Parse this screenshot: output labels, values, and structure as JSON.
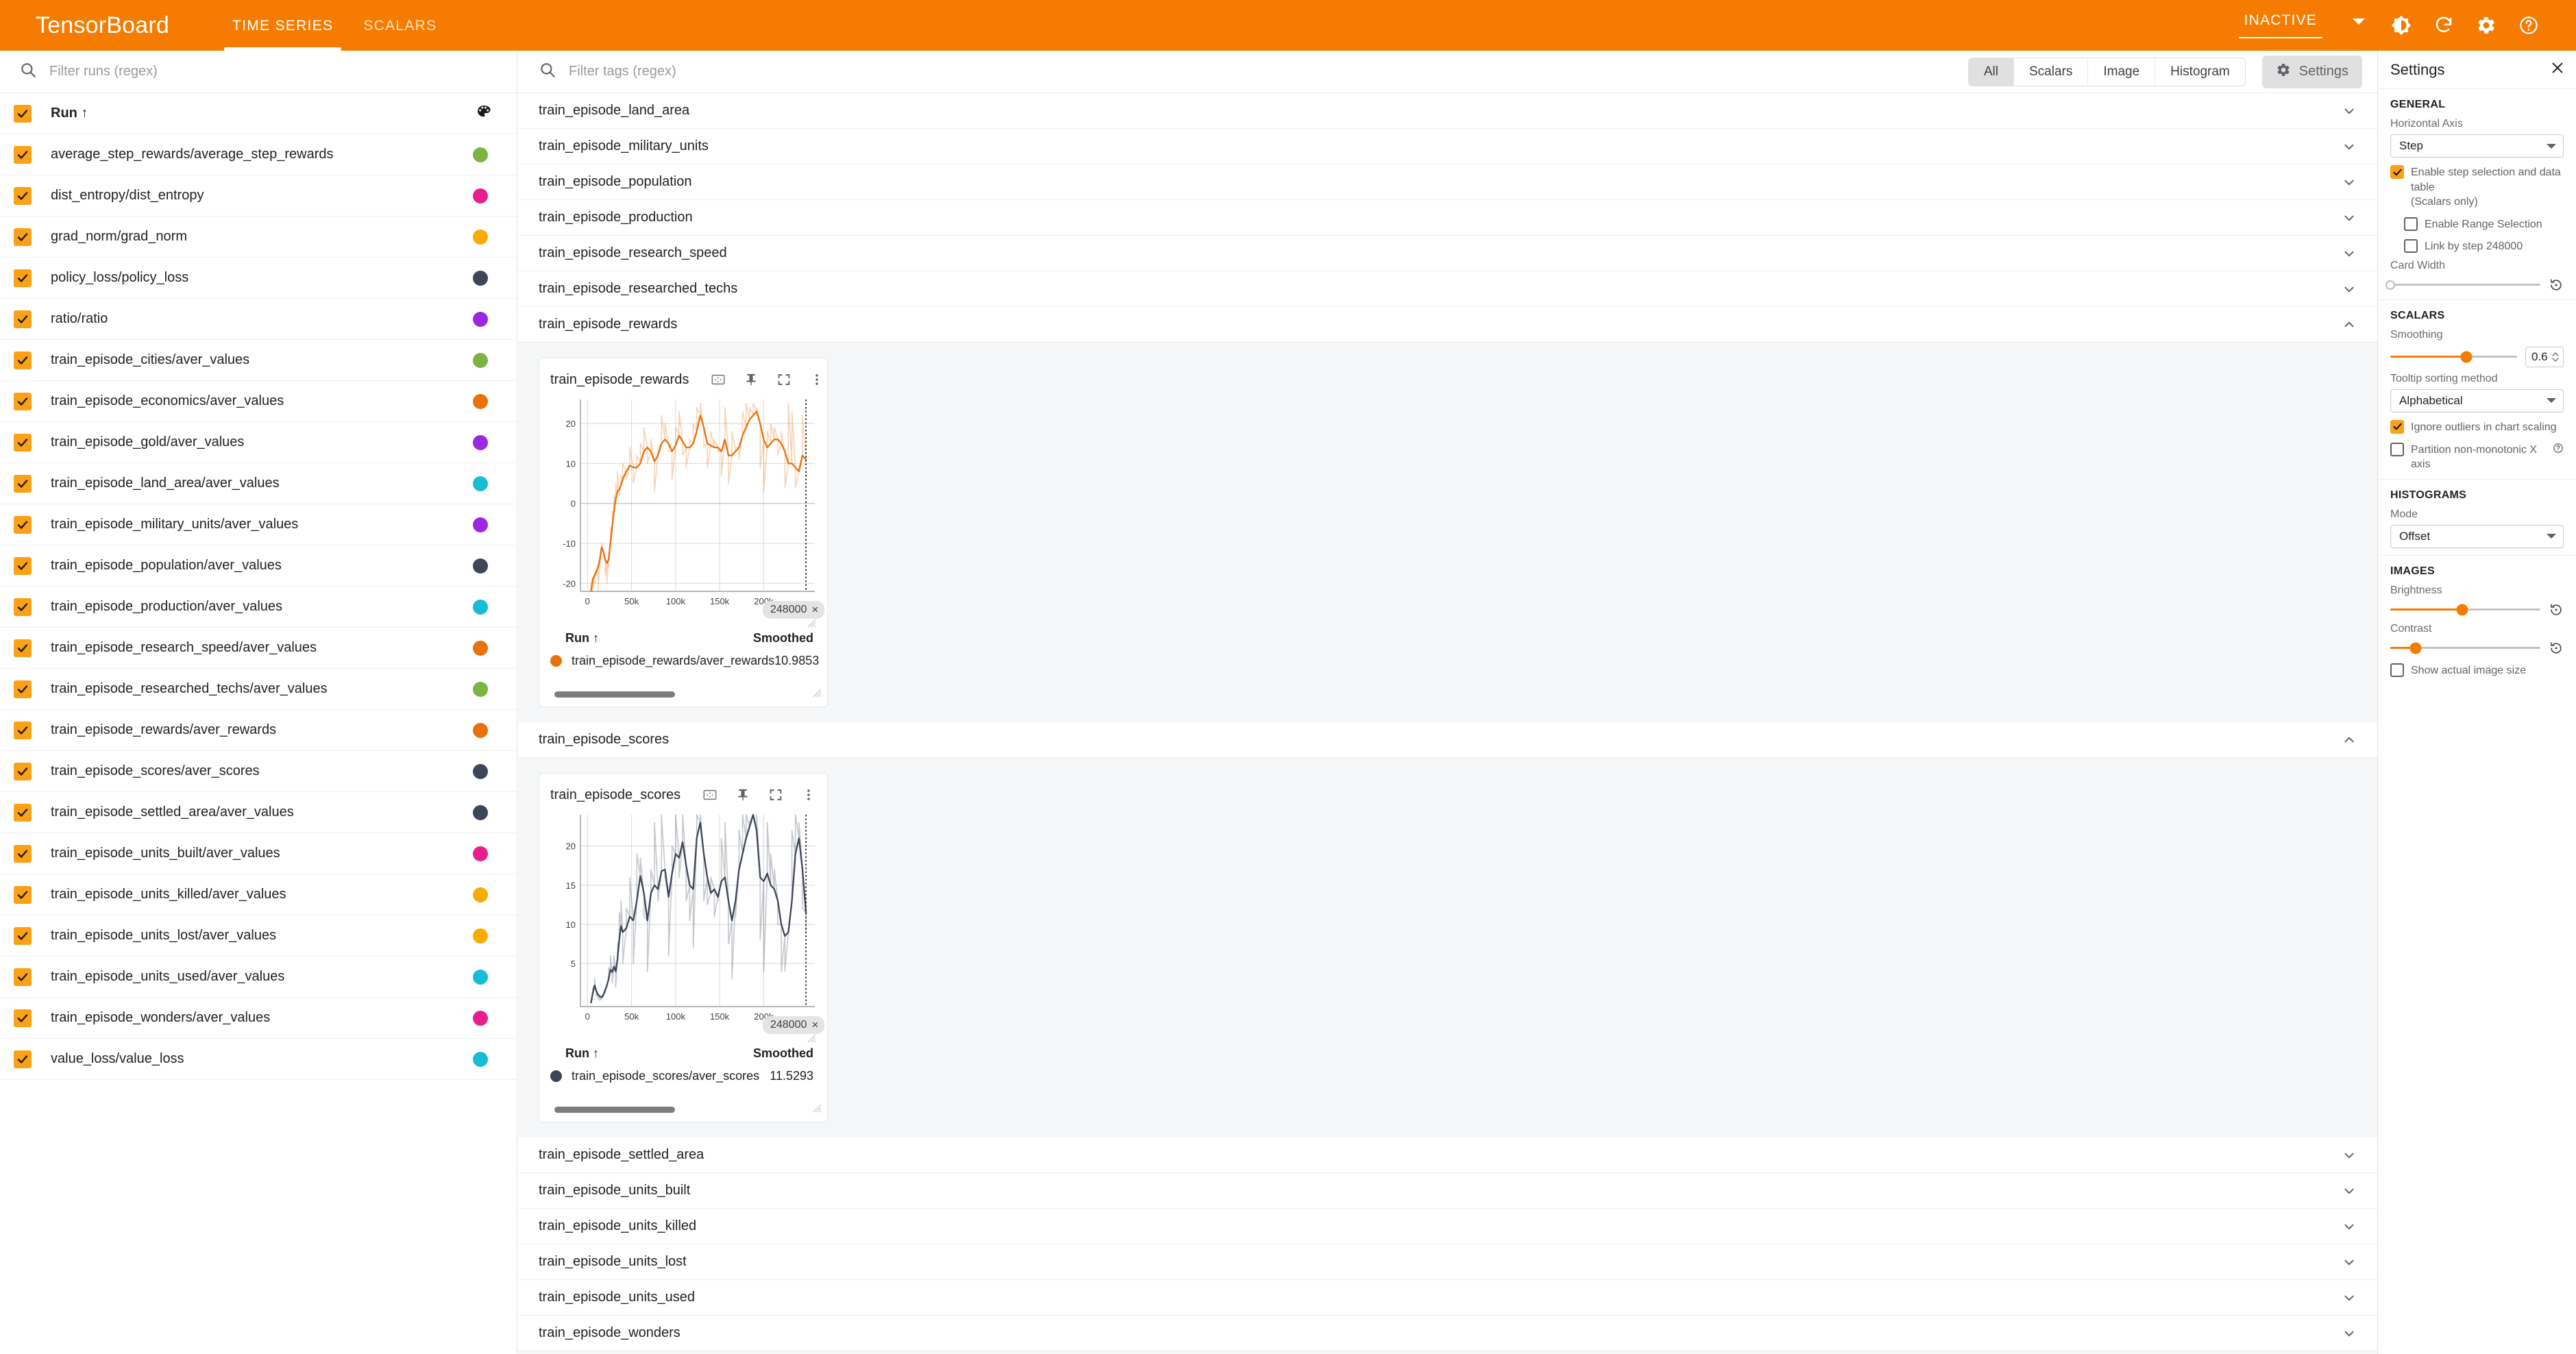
{
  "app": {
    "brand": "TensorBoard",
    "tabs": [
      {
        "label": "TIME SERIES",
        "active": true
      },
      {
        "label": "SCALARS",
        "active": false
      }
    ],
    "status": "INACTIVE",
    "icons": [
      "brightness-icon",
      "reload-icon",
      "gear-icon",
      "help-icon"
    ],
    "accent": "#f57c00",
    "checkbox_color": "#faa118"
  },
  "sidebar": {
    "search": {
      "placeholder": "Filter runs (regex)",
      "icon": "search-icon"
    },
    "header": {
      "label": "Run",
      "sort_arrow": "↑",
      "palette_icon": "palette-icon"
    },
    "runs": [
      {
        "name": "average_step_rewards/average_step_rewards",
        "color": "#7cb342",
        "checked": true
      },
      {
        "name": "dist_entropy/dist_entropy",
        "color": "#e91e8c",
        "checked": true
      },
      {
        "name": "grad_norm/grad_norm",
        "color": "#f9ab00",
        "checked": true
      },
      {
        "name": "policy_loss/policy_loss",
        "color": "#3c4657",
        "checked": true
      },
      {
        "name": "ratio/ratio",
        "color": "#9c27e0",
        "checked": true
      },
      {
        "name": "train_episode_cities/aver_values",
        "color": "#7cb342",
        "checked": true
      },
      {
        "name": "train_episode_economics/aver_values",
        "color": "#e8710a",
        "checked": true
      },
      {
        "name": "train_episode_gold/aver_values",
        "color": "#9c27e0",
        "checked": true
      },
      {
        "name": "train_episode_land_area/aver_values",
        "color": "#16bdd4",
        "checked": true
      },
      {
        "name": "train_episode_military_units/aver_values",
        "color": "#9c27e0",
        "checked": true
      },
      {
        "name": "train_episode_population/aver_values",
        "color": "#3c4657",
        "checked": true
      },
      {
        "name": "train_episode_production/aver_values",
        "color": "#16bdd4",
        "checked": true
      },
      {
        "name": "train_episode_research_speed/aver_values",
        "color": "#e8710a",
        "checked": true
      },
      {
        "name": "train_episode_researched_techs/aver_values",
        "color": "#7cb342",
        "checked": true
      },
      {
        "name": "train_episode_rewards/aver_rewards",
        "color": "#e8710a",
        "checked": true
      },
      {
        "name": "train_episode_scores/aver_scores",
        "color": "#3c4657",
        "checked": true
      },
      {
        "name": "train_episode_settled_area/aver_values",
        "color": "#3c4657",
        "checked": true
      },
      {
        "name": "train_episode_units_built/aver_values",
        "color": "#e91e8c",
        "checked": true
      },
      {
        "name": "train_episode_units_killed/aver_values",
        "color": "#f9ab00",
        "checked": true
      },
      {
        "name": "train_episode_units_lost/aver_values",
        "color": "#f9ab00",
        "checked": true
      },
      {
        "name": "train_episode_units_used/aver_values",
        "color": "#16bdd4",
        "checked": true
      },
      {
        "name": "train_episode_wonders/aver_values",
        "color": "#e91e8c",
        "checked": true
      },
      {
        "name": "value_loss/value_loss",
        "color": "#16bdd4",
        "checked": true
      }
    ]
  },
  "main": {
    "search": {
      "placeholder": "Filter tags (regex)",
      "icon": "search-icon"
    },
    "chips": [
      {
        "label": "All",
        "selected": true
      },
      {
        "label": "Scalars",
        "selected": false
      },
      {
        "label": "Image",
        "selected": false
      },
      {
        "label": "Histogram",
        "selected": false
      }
    ],
    "settings_button": {
      "label": "Settings",
      "icon": "gear-icon"
    },
    "groups": [
      {
        "label": "train_episode_land_area",
        "expanded": false
      },
      {
        "label": "train_episode_military_units",
        "expanded": false
      },
      {
        "label": "train_episode_population",
        "expanded": false
      },
      {
        "label": "train_episode_production",
        "expanded": false
      },
      {
        "label": "train_episode_research_speed",
        "expanded": false
      },
      {
        "label": "train_episode_researched_techs",
        "expanded": false
      },
      {
        "label": "train_episode_rewards",
        "expanded": true
      },
      {
        "label": "train_episode_scores",
        "expanded": true
      },
      {
        "label": "train_episode_settled_area",
        "expanded": false
      },
      {
        "label": "train_episode_units_built",
        "expanded": false
      },
      {
        "label": "train_episode_units_killed",
        "expanded": false
      },
      {
        "label": "train_episode_units_lost",
        "expanded": false
      },
      {
        "label": "train_episode_units_used",
        "expanded": false
      },
      {
        "label": "train_episode_wonders",
        "expanded": false
      }
    ],
    "card_actions": [
      "fit-domain-icon",
      "pin-icon",
      "fullscreen-icon",
      "overflow-menu-icon"
    ],
    "legend_headers": {
      "run": "Run",
      "sort_arrow": "↑",
      "value": "Smoothed"
    },
    "step_pill": {
      "value": "248000",
      "close": "×"
    }
  },
  "chart_data": [
    {
      "type": "line",
      "title": "train_episode_rewards",
      "xlabel": "",
      "ylabel": "",
      "xticks": [
        "0",
        "50k",
        "100k",
        "150k",
        "200k"
      ],
      "xtickvals": [
        0,
        50000,
        100000,
        150000,
        200000
      ],
      "yticks": [
        "20",
        "10",
        "0",
        "-10",
        "-20"
      ],
      "ytickvals": [
        20,
        10,
        0,
        -10,
        -20
      ],
      "xlim": [
        -8000,
        258000
      ],
      "ylim": [
        -22,
        26
      ],
      "grid": true,
      "selected_step": 248000,
      "legend_position": "below",
      "series": [
        {
          "name": "train_episode_rewards/aver_rewards",
          "color": "#e8710a",
          "smoothed_value": "10.9853",
          "x": [
            4000,
            6000,
            8000,
            10000,
            12000,
            14000,
            16000,
            18000,
            20000,
            22000,
            24000,
            26000,
            28000,
            30000,
            32000,
            34000,
            36000,
            38000,
            40000,
            44000,
            48000,
            52000,
            56000,
            60000,
            64000,
            68000,
            72000,
            76000,
            80000,
            84000,
            88000,
            92000,
            96000,
            100000,
            104000,
            108000,
            112000,
            116000,
            120000,
            124000,
            128000,
            132000,
            136000,
            140000,
            144000,
            148000,
            152000,
            156000,
            160000,
            164000,
            168000,
            172000,
            176000,
            180000,
            184000,
            188000,
            192000,
            196000,
            200000,
            204000,
            208000,
            212000,
            216000,
            220000,
            224000,
            228000,
            232000,
            236000,
            240000,
            244000,
            248000
          ],
          "y_smoothed": [
            -22,
            -19,
            -18,
            -17,
            -16,
            -14,
            -11,
            -12,
            -14,
            -15,
            -14,
            -10,
            -6,
            -2,
            1,
            3,
            3.5,
            4.5,
            6,
            8,
            9.5,
            9,
            9,
            10,
            13,
            14,
            13,
            10.5,
            12,
            15,
            16,
            15,
            13,
            14.5,
            17,
            15.5,
            14,
            14,
            15,
            18,
            22,
            19,
            15,
            14.5,
            14,
            14,
            13,
            16,
            12,
            12,
            13,
            14,
            17,
            19,
            21,
            22,
            23,
            20,
            16,
            14,
            15,
            16,
            16,
            15,
            13,
            10,
            10,
            9,
            8,
            12,
            11
          ],
          "y_raw_band": [
            -22,
            -22,
            -20,
            -18,
            -22,
            -16,
            -10,
            -13,
            -18,
            -20,
            -16,
            -6,
            -2,
            2,
            5,
            8,
            2,
            7,
            10,
            6,
            14,
            5,
            12,
            15,
            19,
            10,
            16,
            3,
            14,
            22,
            20,
            13,
            6,
            19,
            23,
            12,
            9,
            16,
            20,
            24,
            25,
            14,
            9,
            18,
            16,
            13,
            7,
            24,
            5,
            18,
            14,
            11,
            23,
            25,
            24,
            25,
            24,
            9,
            3,
            18,
            20,
            19,
            12,
            18,
            4,
            25,
            23,
            4,
            9,
            22,
            10
          ]
        }
      ]
    },
    {
      "type": "line",
      "title": "train_episode_scores",
      "xlabel": "",
      "ylabel": "",
      "xticks": [
        "0",
        "50k",
        "100k",
        "150k",
        "200k"
      ],
      "xtickvals": [
        0,
        50000,
        100000,
        150000,
        200000
      ],
      "yticks": [
        "20",
        "15",
        "10",
        "5"
      ],
      "ytickvals": [
        20,
        15,
        10,
        5
      ],
      "xlim": [
        -8000,
        258000
      ],
      "ylim": [
        -0.5,
        24
      ],
      "grid": true,
      "selected_step": 248000,
      "legend_position": "below",
      "series": [
        {
          "name": "train_episode_scores/aver_scores",
          "color": "#3c4657",
          "smoothed_value": "11.5293",
          "x": [
            4000,
            6000,
            8000,
            10000,
            12000,
            14000,
            16000,
            18000,
            20000,
            22000,
            24000,
            26000,
            28000,
            30000,
            32000,
            34000,
            36000,
            38000,
            40000,
            44000,
            48000,
            52000,
            56000,
            60000,
            64000,
            68000,
            72000,
            76000,
            80000,
            84000,
            88000,
            92000,
            96000,
            100000,
            104000,
            108000,
            112000,
            116000,
            120000,
            124000,
            128000,
            132000,
            136000,
            140000,
            144000,
            148000,
            152000,
            156000,
            160000,
            164000,
            168000,
            172000,
            176000,
            180000,
            184000,
            188000,
            192000,
            196000,
            200000,
            204000,
            208000,
            212000,
            216000,
            220000,
            224000,
            228000,
            232000,
            236000,
            240000,
            244000,
            248000
          ],
          "y_smoothed": [
            0,
            1.2,
            2.2,
            1.5,
            1.0,
            0.8,
            0.7,
            1.0,
            1.6,
            2.2,
            3.0,
            4.2,
            3.9,
            4.6,
            4.0,
            5.5,
            8.0,
            9.8,
            9.0,
            9.5,
            11.0,
            10.5,
            13.0,
            16.2,
            14.0,
            10.5,
            14.0,
            15.0,
            14.5,
            16.8,
            17.0,
            13.5,
            16.5,
            19.0,
            18.5,
            20.5,
            17.5,
            15.0,
            14.5,
            21.0,
            23.0,
            19.0,
            16.0,
            14.0,
            14.5,
            13.5,
            15.5,
            16.0,
            13.0,
            10.5,
            13.0,
            17.0,
            19.0,
            21.0,
            22.5,
            24.0,
            22.0,
            16.0,
            15.5,
            16.5,
            15.0,
            14.5,
            13.0,
            10.0,
            8.5,
            9.0,
            13.0,
            19.0,
            21.0,
            17.0,
            11.5
          ],
          "y_raw_band": [
            0,
            1.8,
            3.0,
            0.8,
            0.5,
            0.3,
            0.4,
            0.7,
            1.2,
            2.0,
            4.5,
            6.0,
            2.5,
            6.0,
            2.0,
            7.5,
            11.5,
            13.0,
            5.0,
            12.0,
            16.0,
            5.0,
            19.0,
            18.5,
            11.0,
            4.0,
            17.0,
            23.0,
            13.0,
            24.0,
            16.0,
            6.0,
            20.0,
            24.0,
            16.0,
            24.0,
            13.0,
            10.5,
            7.0,
            24.0,
            24.0,
            13.0,
            12.5,
            16.0,
            11.0,
            13.0,
            21.0,
            23.0,
            7.5,
            3.0,
            11.0,
            22.0,
            24.0,
            24.0,
            23.0,
            24.0,
            24.0,
            8.0,
            4.0,
            23.0,
            19.0,
            17.0,
            10.0,
            4.0,
            4.0,
            9.0,
            22.0,
            24.0,
            23.0,
            12.0,
            9.0
          ]
        }
      ]
    }
  ],
  "settings": {
    "title": "Settings",
    "close_icon": "close-icon",
    "general": {
      "title": "GENERAL",
      "horizontal_axis_label": "Horizontal Axis",
      "horizontal_axis_value": "Step",
      "enable_step_selection_label": "Enable step selection and data table",
      "enable_step_selection_sub": "(Scalars only)",
      "enable_step_selection_checked": true,
      "enable_range_selection_label": "Enable Range Selection",
      "enable_range_selection_checked": false,
      "link_by_step_label": "Link by step 248000",
      "link_by_step_checked": false,
      "card_width_label": "Card Width",
      "card_width_pct": 0,
      "reset_icon": "reset-icon"
    },
    "scalars": {
      "title": "SCALARS",
      "smoothing_label": "Smoothing",
      "smoothing_value": "0.6",
      "smoothing_pct": 60,
      "tooltip_sorting_label": "Tooltip sorting method",
      "tooltip_sorting_value": "Alphabetical",
      "ignore_outliers_label": "Ignore outliers in chart scaling",
      "ignore_outliers_checked": true,
      "partition_label": "Partition non-monotonic X axis",
      "partition_checked": false,
      "help_icon": "help-icon"
    },
    "histograms": {
      "title": "HISTOGRAMS",
      "mode_label": "Mode",
      "mode_value": "Offset"
    },
    "images": {
      "title": "IMAGES",
      "brightness_label": "Brightness",
      "brightness_pct": 48,
      "contrast_label": "Contrast",
      "contrast_pct": 17,
      "show_actual_label": "Show actual image size",
      "show_actual_checked": false,
      "reset_icon": "reset-icon"
    }
  }
}
